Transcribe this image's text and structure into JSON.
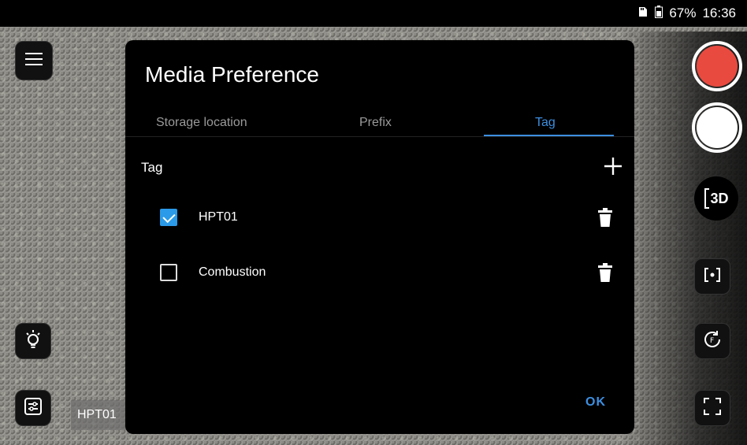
{
  "status_bar": {
    "battery": "67%",
    "time": "16:36"
  },
  "dialog": {
    "title": "Media Preference",
    "tabs": [
      {
        "label": "Storage location",
        "active": false
      },
      {
        "label": "Prefix",
        "active": false
      },
      {
        "label": "Tag",
        "active": true
      }
    ],
    "section_label": "Tag",
    "tags": [
      {
        "label": "HPT01",
        "checked": true
      },
      {
        "label": "Combustion",
        "checked": false
      }
    ],
    "ok_label": "OK"
  },
  "overlay_tag": "HPT01",
  "btn_3d_label": "3D",
  "colors": {
    "accent": "#3d8fe0",
    "record": "#e84a3f",
    "checkbox": "#2b9ae8"
  }
}
